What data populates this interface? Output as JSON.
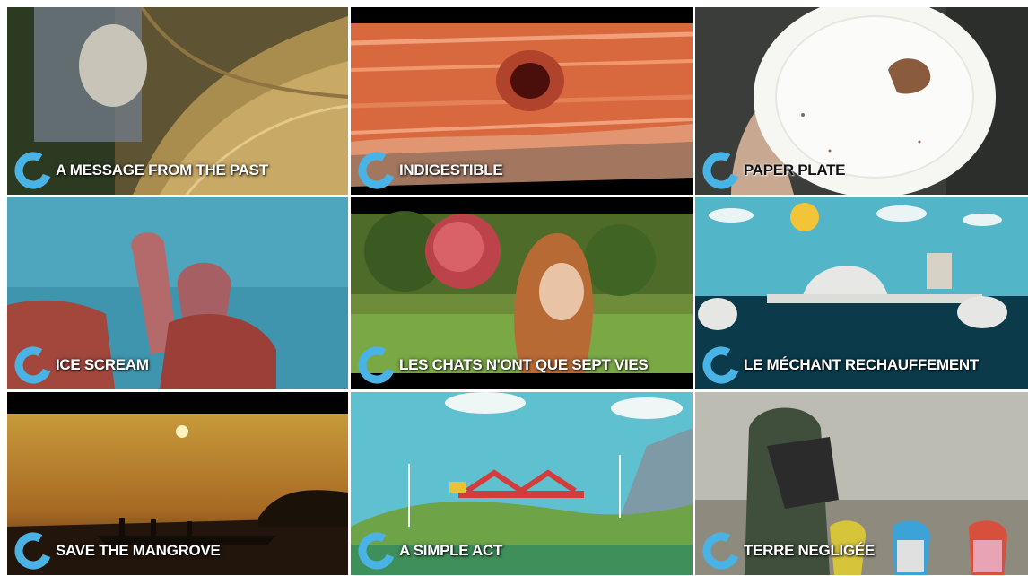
{
  "logo_color": "#4ab3e6",
  "tiles": [
    {
      "title": "A MESSAGE FROM THE PAST"
    },
    {
      "title": "INDIGESTIBLE"
    },
    {
      "title": "PAPER PLATE"
    },
    {
      "title": "ICE SCREAM"
    },
    {
      "title": "LES CHATS N'ONT QUE SEPT VIES"
    },
    {
      "title": "LE MÉCHANT RECHAUFFEMENT"
    },
    {
      "title": "SAVE THE MANGROVE"
    },
    {
      "title": "A SIMPLE ACT"
    },
    {
      "title": "TERRE NEGLIGÉE"
    }
  ]
}
